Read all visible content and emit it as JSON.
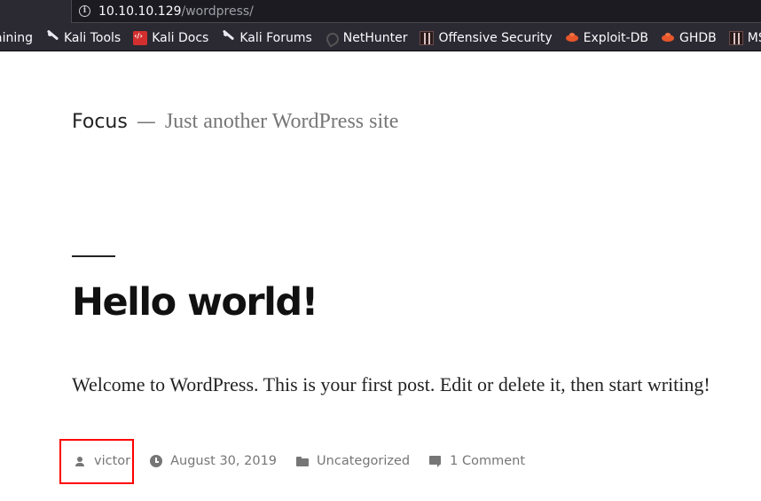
{
  "browser": {
    "url_host": "10.10.10.129",
    "url_path": "/wordpress/",
    "bookmarks": [
      {
        "label": "aining",
        "icon": "kali-dragon-icon"
      },
      {
        "label": "Kali Tools",
        "icon": "kali-dragon-icon"
      },
      {
        "label": "Kali Docs",
        "icon": "kali-docs-icon"
      },
      {
        "label": "Kali Forums",
        "icon": "kali-dragon-icon"
      },
      {
        "label": "NetHunter",
        "icon": "nethunter-icon"
      },
      {
        "label": "Offensive Security",
        "icon": "offsec-icon"
      },
      {
        "label": "Exploit-DB",
        "icon": "exploit-db-icon"
      },
      {
        "label": "GHDB",
        "icon": "exploit-db-icon"
      },
      {
        "label": "MSFU",
        "icon": "offsec-icon"
      }
    ]
  },
  "site": {
    "title": "Focus",
    "separator": "—",
    "description": "Just another WordPress site"
  },
  "post": {
    "title": "Hello world!",
    "content": "Welcome to WordPress. This is your first post. Edit or delete it, then start writing!",
    "meta": {
      "author": "victor",
      "date": "August 30, 2019",
      "category": "Uncategorized",
      "comments": "1 Comment"
    }
  },
  "colors": {
    "highlight": "#ff0000",
    "meta_text": "#767676",
    "browser_bg": "#2b2a33"
  }
}
